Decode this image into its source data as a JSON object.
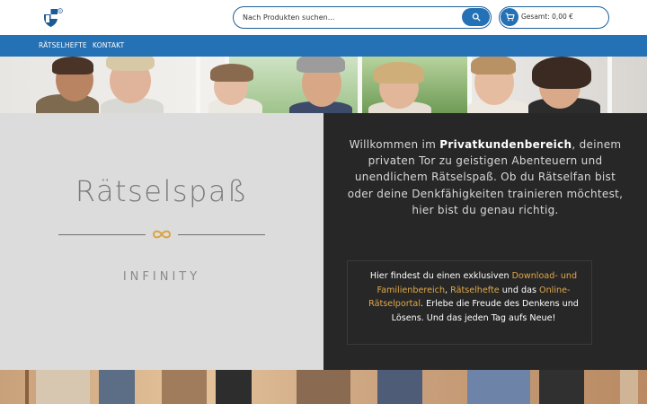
{
  "header": {
    "search_placeholder": "Nach Produkten suchen...",
    "cart_label": "Gesamt: 0,00 €"
  },
  "nav": {
    "items": [
      {
        "label": "RÄTSELHEFTE"
      },
      {
        "label": "KONTAKT"
      }
    ]
  },
  "brand": {
    "title": "Rätselspaß",
    "subtitle": "INFINITY"
  },
  "intro": {
    "part1": "Willkommen im ",
    "bold": "Privatkundenbereich",
    "part2": ", deinem privaten Tor zu geistigen Abenteuern und unendlichem Rätselspaß. Ob du Rätselfan bist oder deine Denkfähigkeiten trainieren möchtest, hier bist du genau richtig."
  },
  "info": {
    "t1": "Hier findest du einen exklusiven ",
    "link1": "Download- und Familienbereich",
    "t2": ", ",
    "link2": "Rätselhefte",
    "t3": " und das ",
    "link3": "Online-Rätselportal",
    "t4": ". Erlebe die Freude des Denkens und Lösens. Und das jeden Tag aufs Neue!"
  },
  "colors": {
    "primary": "#2471b5",
    "accent": "#e0a84a",
    "dark_panel": "#272727",
    "light_panel": "#dcdcdc"
  },
  "icons": {
    "logo": "shield-logo",
    "search": "search-icon",
    "cart": "cart-icon",
    "infinity": "infinity-icon"
  }
}
